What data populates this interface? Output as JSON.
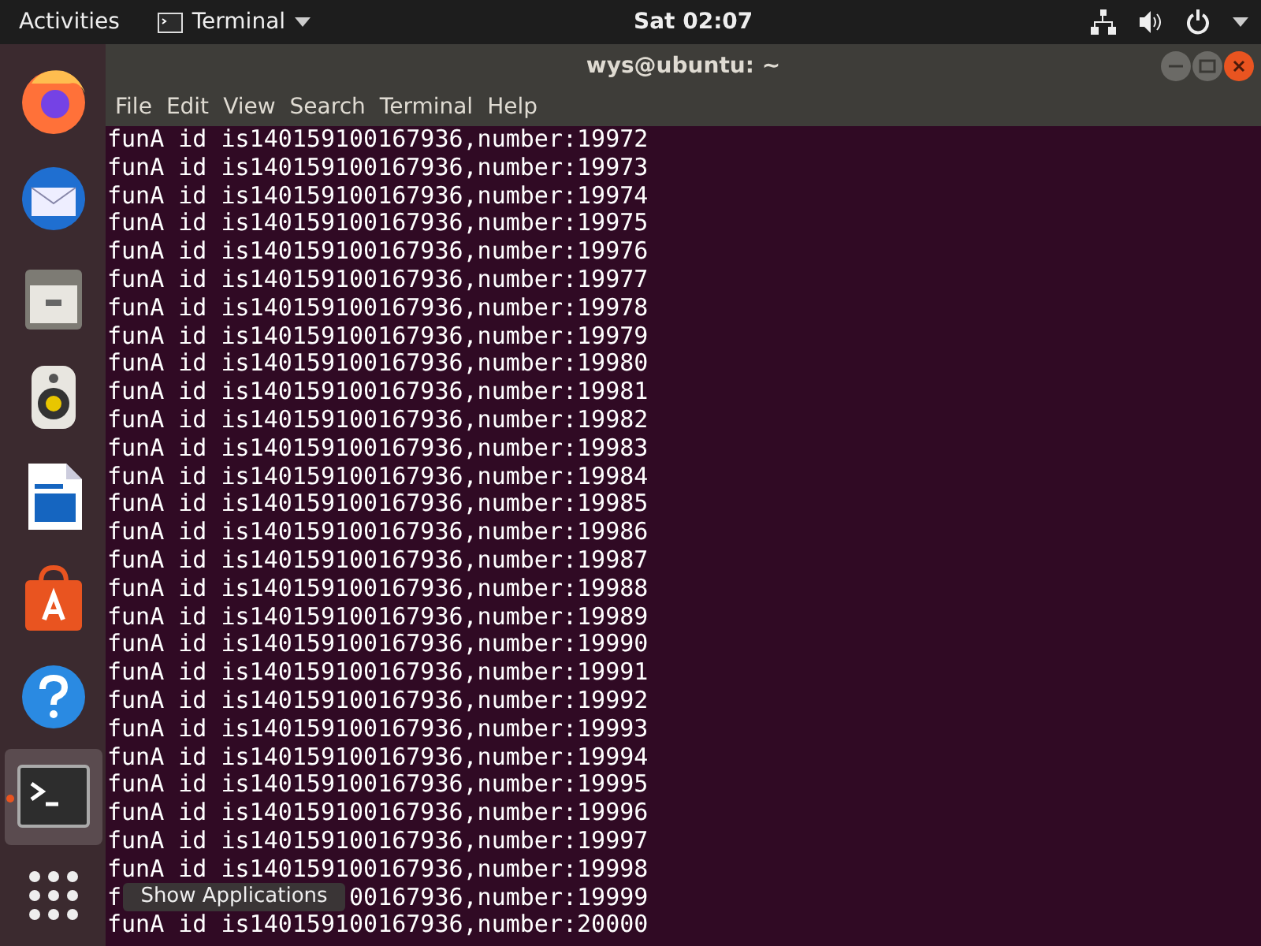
{
  "top_bar": {
    "activities": "Activities",
    "app_menu": "Terminal",
    "clock": "Sat 02:07"
  },
  "dock": {
    "items": [
      {
        "kind": "firefox",
        "running": false
      },
      {
        "kind": "mail",
        "running": false
      },
      {
        "kind": "files",
        "running": false
      },
      {
        "kind": "music",
        "running": false
      },
      {
        "kind": "writer",
        "running": false
      },
      {
        "kind": "software",
        "running": false
      },
      {
        "kind": "help",
        "running": false
      },
      {
        "kind": "terminal",
        "running": true
      },
      {
        "kind": "apps",
        "running": false
      }
    ],
    "tooltip": "Show Applications"
  },
  "window": {
    "title": "wys@ubuntu: ~",
    "menu": [
      "File",
      "Edit",
      "View",
      "Search",
      "Terminal",
      "Help"
    ]
  },
  "terminal_lines": [
    "funA id is140159100167936,number:19972",
    "funA id is140159100167936,number:19973",
    "funA id is140159100167936,number:19974",
    "funA id is140159100167936,number:19975",
    "funA id is140159100167936,number:19976",
    "funA id is140159100167936,number:19977",
    "funA id is140159100167936,number:19978",
    "funA id is140159100167936,number:19979",
    "funA id is140159100167936,number:19980",
    "funA id is140159100167936,number:19981",
    "funA id is140159100167936,number:19982",
    "funA id is140159100167936,number:19983",
    "funA id is140159100167936,number:19984",
    "funA id is140159100167936,number:19985",
    "funA id is140159100167936,number:19986",
    "funA id is140159100167936,number:19987",
    "funA id is140159100167936,number:19988",
    "funA id is140159100167936,number:19989",
    "funA id is140159100167936,number:19990",
    "funA id is140159100167936,number:19991",
    "funA id is140159100167936,number:19992",
    "funA id is140159100167936,number:19993",
    "funA id is140159100167936,number:19994",
    "funA id is140159100167936,number:19995",
    "funA id is140159100167936,number:19996",
    "funA id is140159100167936,number:19997",
    "funA id is140159100167936,number:19998",
    {
      "before_tooltip": "f",
      "after_tooltip": "00167936,number:19999"
    },
    "funA id is140159100167936,number:20000"
  ]
}
